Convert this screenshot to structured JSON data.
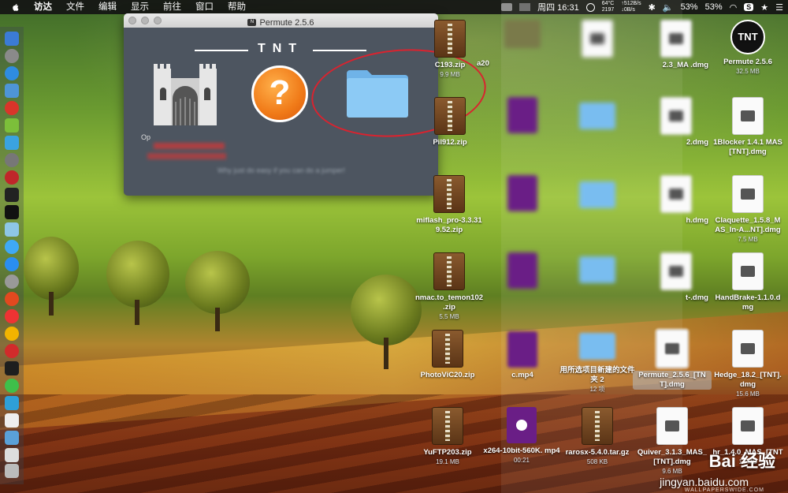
{
  "menubar": {
    "items": [
      "访达",
      "文件",
      "编辑",
      "显示",
      "前往",
      "窗口",
      "帮助"
    ],
    "clock": "周四 16:31",
    "cpu_temp": "64°C",
    "cpu_fan": "2197",
    "net_up": "↑512B/s",
    "net_down": "↓0B/s",
    "battery1": "53%",
    "battery2": "53%"
  },
  "window": {
    "title": "Permute 2.5.6",
    "badge": "N",
    "brand": "TNT",
    "help_glyph": "?",
    "op_label": "Op",
    "hint": "Why just do easy if you can do a jumper!"
  },
  "desktop": {
    "col1": [
      {
        "name": "C193.zip",
        "size": "9.9 MB"
      },
      {
        "name": "Pil912.zip",
        "size": ""
      },
      {
        "name": "miflash_pro-3.3.31 9.52.zip",
        "size": ""
      },
      {
        "name": "nmac.to_temon102 .zip",
        "size": "5.5 MB"
      },
      {
        "name": "PhotoViC20.zip",
        "size": ""
      },
      {
        "name": "YuFTP203.zip",
        "size": "19.1 MB"
      }
    ],
    "col2": [
      {
        "name": "a20",
        "size": ""
      },
      {
        "name": "c.mp4",
        "size": ""
      },
      {
        "name": "x264-10bit-560K. mp4",
        "size": "00:21"
      }
    ],
    "col3": [
      {
        "name": "用所选项目新建的文件夹 2",
        "size": "12 项"
      },
      {
        "name": "rarosx-5.4.0.tar.gz",
        "size": "508 KB"
      }
    ],
    "col4": [
      {
        "name": "2.3_MA .dmg",
        "size": ""
      },
      {
        "name": "2.dmg",
        "size": ""
      },
      {
        "name": "h.dmg",
        "size": ""
      },
      {
        "name": "t-.dmg",
        "size": ""
      },
      {
        "name": "Permute_2.5.6_[TN T].dmg",
        "size": ""
      },
      {
        "name": "Quiver_3.1.3_MAS_ [TNT].dmg",
        "size": "9.6 MB"
      }
    ],
    "col5": [
      {
        "name": "Permute 2.5.6",
        "size": "32.5 MB"
      },
      {
        "name": "1Blocker 1.4.1 MAS [TNT].dmg",
        "size": ""
      },
      {
        "name": "Claquette_1.5.8_M AS_In-A...NT].dmg",
        "size": "7.5 MB"
      },
      {
        "name": "HandBrake-1.1.0.d mg",
        "size": ""
      },
      {
        "name": "Hedge_18.2_[TNT]. dmg",
        "size": "15.6 MB"
      },
      {
        "name": "hr_1.4.0_MAS_[TNT",
        "size": "14 MB"
      }
    ]
  },
  "watermark": {
    "brand": "Bai 经验",
    "url": "jingyan.baidu.com",
    "credit": "WALLPAPERSWIDE.COM"
  },
  "colors": {
    "window_bg": "#4d5560",
    "help_orange": "#f07a18",
    "folder_blue": "#79bdf0",
    "annotation_red": "#d9232f"
  }
}
